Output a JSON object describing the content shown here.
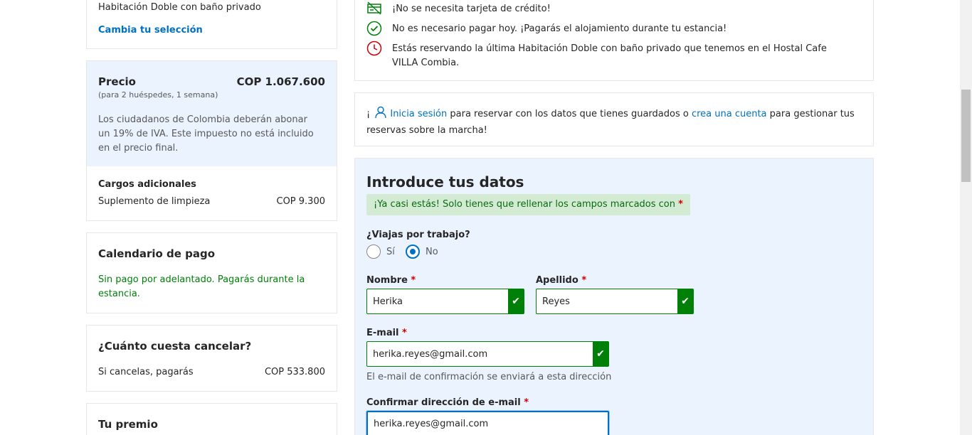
{
  "room": {
    "name": "Habitación Doble con baño privado",
    "change_link": "Cambia tu selección"
  },
  "price": {
    "label": "Precio",
    "amount": "COP 1.067.600",
    "guests": "(para 2 huéspedes, 1 semana)",
    "tax_note": "Los ciudadanos de Colombia deberán abonar un 19% de IVA. Este impuesto no está incluido en el precio final."
  },
  "extra_charges": {
    "title": "Cargos adicionales",
    "item_label": "Suplemento de limpieza",
    "item_amount": "COP 9.300"
  },
  "payment_schedule": {
    "title": "Calendario de pago",
    "text": "Sin pago por adelantado. Pagarás durante la estancia."
  },
  "cancellation": {
    "title": "¿Cuánto cuesta cancelar?",
    "label": "Si cancelas, pagarás",
    "amount": "COP 533.800"
  },
  "reward": {
    "title": "Tu premio"
  },
  "benefits": [
    "¡No se necesita tarjeta de crédito!",
    "No es necesario pagar hoy. ¡Pagarás el alojamiento durante tu estancia!",
    "Estás reservando la última Habitación Doble con baño privado que tenemos en el Hostal Cafe VILLA Combia."
  ],
  "signin": {
    "prefix": "¡",
    "link": "Inicia sesión",
    "middle": " para reservar con los datos que tienes guardados o ",
    "link2": "crea una cuenta",
    "suffix": " para gestionar tus reservas sobre la marcha!"
  },
  "form": {
    "title": "Introduce tus datos",
    "notice": "¡Ya casi estás! Solo tienes que rellenar los campos marcados con",
    "required_mark": "*",
    "business_question": "¿Viajas por trabajo?",
    "business_options": [
      "Sí",
      "No"
    ],
    "business_selected": "No",
    "first_name_label": "Nombre",
    "first_name_value": "Herika",
    "last_name_label": "Apellido",
    "last_name_value": "Reyes",
    "email_label": "E-mail",
    "email_value": "herika.reyes@gmail.com",
    "email_hint": "El e-mail de confirmación se enviará a esta dirección",
    "confirm_email_label": "Confirmar dirección de e-mail",
    "confirm_email_value": "herika.reyes@gmail.com",
    "check_glyph": "✔"
  },
  "colors": {
    "accent": "#0071c2",
    "success": "#008009",
    "price_bg": "#ebf3ff",
    "alert_red": "#cc0000"
  }
}
